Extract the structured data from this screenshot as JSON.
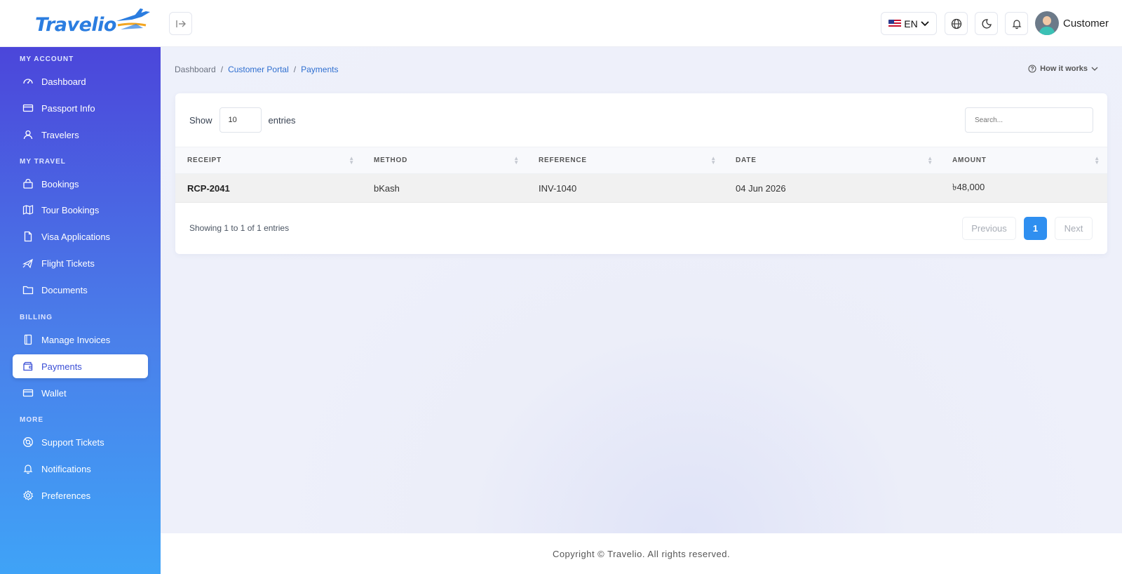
{
  "header": {
    "logo_text": "Travelio",
    "language": "EN",
    "user_name": "Customer"
  },
  "sidebar": {
    "sections": [
      {
        "title": "MY ACCOUNT",
        "items": [
          {
            "label": "Dashboard",
            "icon": "gauge-icon"
          },
          {
            "label": "Passport Info",
            "icon": "card-icon"
          },
          {
            "label": "Travelers",
            "icon": "user-icon"
          }
        ]
      },
      {
        "title": "MY TRAVEL",
        "items": [
          {
            "label": "Bookings",
            "icon": "bag-icon"
          },
          {
            "label": "Tour Bookings",
            "icon": "map-icon"
          },
          {
            "label": "Visa Applications",
            "icon": "file-icon"
          },
          {
            "label": "Flight Tickets",
            "icon": "plane-icon"
          },
          {
            "label": "Documents",
            "icon": "folder-icon"
          }
        ]
      },
      {
        "title": "BILLING",
        "items": [
          {
            "label": "Manage Invoices",
            "icon": "receipt-icon"
          },
          {
            "label": "Payments",
            "icon": "wallet-icon",
            "active": true
          },
          {
            "label": "Wallet",
            "icon": "card-icon"
          }
        ]
      },
      {
        "title": "MORE",
        "items": [
          {
            "label": "Support Tickets",
            "icon": "lifebuoy-icon"
          },
          {
            "label": "Notifications",
            "icon": "bell-icon"
          },
          {
            "label": "Preferences",
            "icon": "gear-icon"
          }
        ]
      }
    ]
  },
  "breadcrumb": {
    "items": [
      "Dashboard",
      "Customer Portal",
      "Payments"
    ],
    "separator": "/"
  },
  "help": {
    "label": "How it works"
  },
  "table_controls": {
    "show_label": "Show",
    "entries_value": "10",
    "entries_label": "entries",
    "search_placeholder": "Search..."
  },
  "table": {
    "columns": [
      "RECEIPT",
      "METHOD",
      "REFERENCE",
      "DATE",
      "AMOUNT"
    ],
    "rows": [
      [
        "RCP-2041",
        "bKash",
        "INV-1040",
        "04 Jun 2026",
        "৳48,000"
      ]
    ]
  },
  "pagination": {
    "info": "Showing 1 to 1 of 1 entries",
    "previous": "Previous",
    "current": "1",
    "next": "Next"
  },
  "footer": {
    "text": "Copyright © Travelio. All rights reserved."
  },
  "colors": {
    "brand": "#2b7de0",
    "sidebar_top": "#4b46da",
    "sidebar_bottom": "#3fa3f7",
    "active_page": "#2f8ff0"
  }
}
